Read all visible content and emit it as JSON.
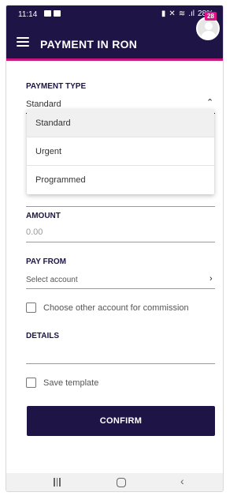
{
  "status_bar": {
    "time": "11:14",
    "battery": "28%"
  },
  "header": {
    "title": "PAYMENT IN RON",
    "notification_count": "28"
  },
  "payment_type": {
    "label": "PAYMENT TYPE",
    "value": "Standard",
    "options": [
      "Standard",
      "Urgent",
      "Programmed"
    ]
  },
  "amount": {
    "label": "AMOUNT",
    "placeholder": "0.00"
  },
  "pay_from": {
    "label": "PAY FROM",
    "placeholder": "Select account"
  },
  "commission_checkbox": {
    "label": "Choose other account for commission",
    "checked": false
  },
  "details": {
    "label": "DETAILS",
    "value": ""
  },
  "save_template": {
    "label": "Save template",
    "checked": false
  },
  "confirm_button": {
    "label": "CONFIRM"
  },
  "icons": {
    "menu": "hamburger-menu-icon",
    "avatar": "user-avatar-icon",
    "chevron_up": "chevron-up-icon",
    "chevron_right": "chevron-right-icon"
  },
  "colors": {
    "primary": "#1f1446",
    "accent": "#c8167e"
  }
}
